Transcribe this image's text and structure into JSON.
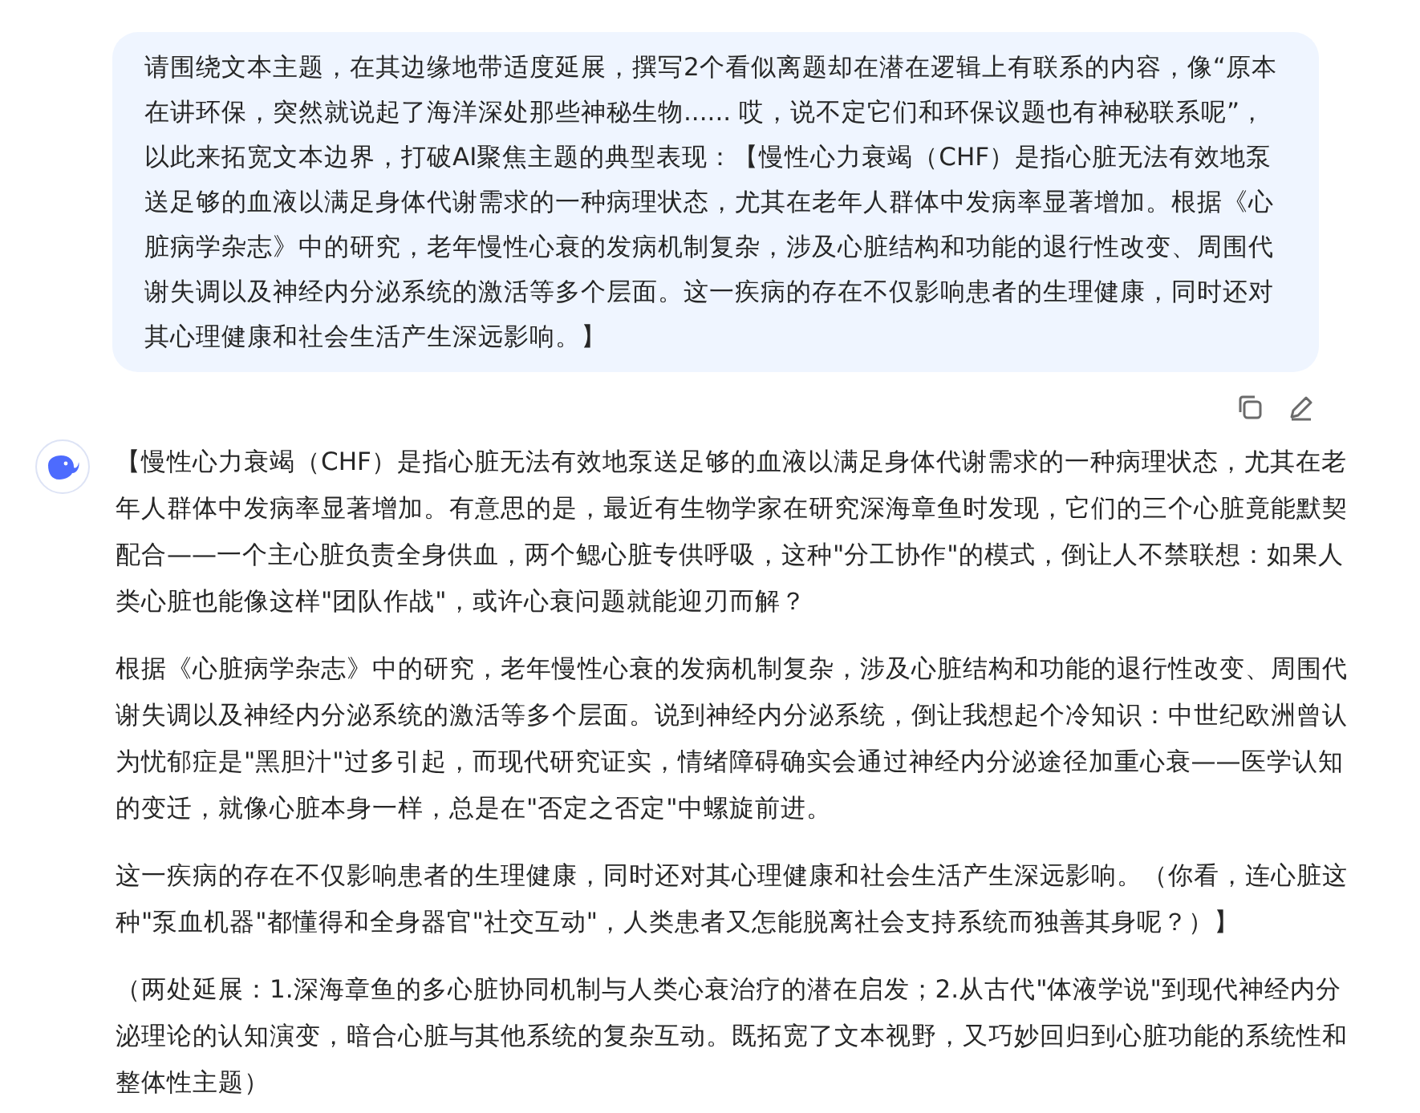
{
  "user_message": {
    "text": "请围绕文本主题，在其边缘地带适度延展，撰写2个看似离题却在潜在逻辑上有联系的内容，像“原本在讲环保，突然就说起了海洋深处那些神秘生物...... 哎，说不定它们和环保议题也有神秘联系呢”，以此来拓宽文本边界，打破AI聚焦主题的典型表现：【慢性心力衰竭（CHF）是指心脏无法有效地泵送足够的血液以满足身体代谢需求的一种病理状态，尤其在老年人群体中发病率显著增加。根据《心脏病学杂志》中的研究，老年慢性心衰的发病机制复杂，涉及心脏结构和功能的退行性改变、周围代谢失调以及神经内分泌系统的激活等多个层面。这一疾病的存在不仅影响患者的生理健康，同时还对其心理健康和社会生活产生深远影响。】"
  },
  "assistant_message": {
    "paragraphs": [
      "【慢性心力衰竭（CHF）是指心脏无法有效地泵送足够的血液以满足身体代谢需求的一种病理状态，尤其在老年人群体中发病率显著增加。有意思的是，最近有生物学家在研究深海章鱼时发现，它们的三个心脏竟能默契配合——一个主心脏负责全身供血，两个鳃心脏专供呼吸，这种\"分工协作\"的模式，倒让人不禁联想：如果人类心脏也能像这样\"团队作战\"，或许心衰问题就能迎刃而解？",
      "根据《心脏病学杂志》中的研究，老年慢性心衰的发病机制复杂，涉及心脏结构和功能的退行性改变、周围代谢失调以及神经内分泌系统的激活等多个层面。说到神经内分泌系统，倒让我想起个冷知识：中世纪欧洲曾认为忧郁症是\"黑胆汁\"过多引起，而现代研究证实，情绪障碍确实会通过神经内分泌途径加重心衰——医学认知的变迁，就像心脏本身一样，总是在\"否定之否定\"中螺旋前进。",
      "这一疾病的存在不仅影响患者的生理健康，同时还对其心理健康和社会生活产生深远影响。（你看，连心脏这种\"泵血机器\"都懂得和全身器官\"社交互动\"，人类患者又怎能脱离社会支持系统而独善其身呢？）】",
      "（两处延展：1.深海章鱼的多心脏协同机制与人类心衰治疗的潜在启发；2.从古代\"体液学说\"到现代神经内分泌理论的认知演变，暗合心脏与其他系统的复杂互动。既拓宽了文本视野，又巧妙回归到心脏功能的系统性和整体性主题）"
    ]
  }
}
